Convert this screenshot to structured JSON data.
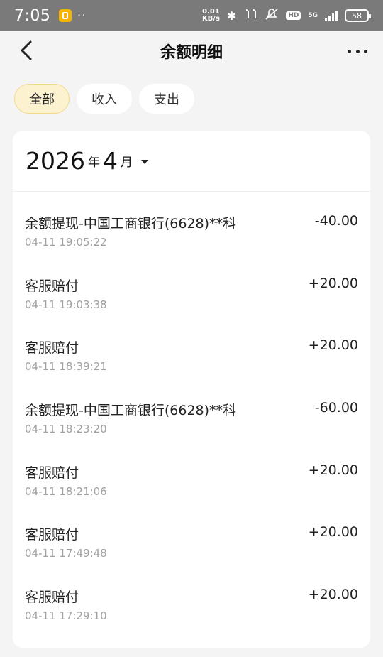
{
  "status_bar": {
    "time": "7:05",
    "dots": "··",
    "speed_value": "0.01",
    "speed_unit": "KB/s",
    "network": "5G",
    "hd": "HD",
    "battery": "58"
  },
  "header": {
    "title": "余额明细"
  },
  "tabs": [
    {
      "label": "全部",
      "active": true
    },
    {
      "label": "收入",
      "active": false
    },
    {
      "label": "支出",
      "active": false
    }
  ],
  "month_selector": {
    "year": "2026",
    "year_unit": "年",
    "month": "4",
    "month_unit": "月"
  },
  "transactions": [
    {
      "title": "余额提现-中国工商银行(6628)**科",
      "time": "04-11 19:05:22",
      "amount": "-40.00"
    },
    {
      "title": "客服赔付",
      "time": "04-11 19:03:38",
      "amount": "+20.00"
    },
    {
      "title": "客服赔付",
      "time": "04-11 18:39:21",
      "amount": "+20.00"
    },
    {
      "title": "余额提现-中国工商银行(6628)**科",
      "time": "04-11 18:23:20",
      "amount": "-60.00"
    },
    {
      "title": "客服赔付",
      "time": "04-11 18:21:06",
      "amount": "+20.00"
    },
    {
      "title": "客服赔付",
      "time": "04-11 17:49:48",
      "amount": "+20.00"
    },
    {
      "title": "客服赔付",
      "time": "04-11 17:29:10",
      "amount": "+20.00"
    }
  ],
  "colors": {
    "status_bar_bg": "#7a7a7a",
    "active_tab_bg": "#fdf2cf",
    "active_tab_border": "#f2d98a",
    "page_bg": "#f4f4f4"
  }
}
